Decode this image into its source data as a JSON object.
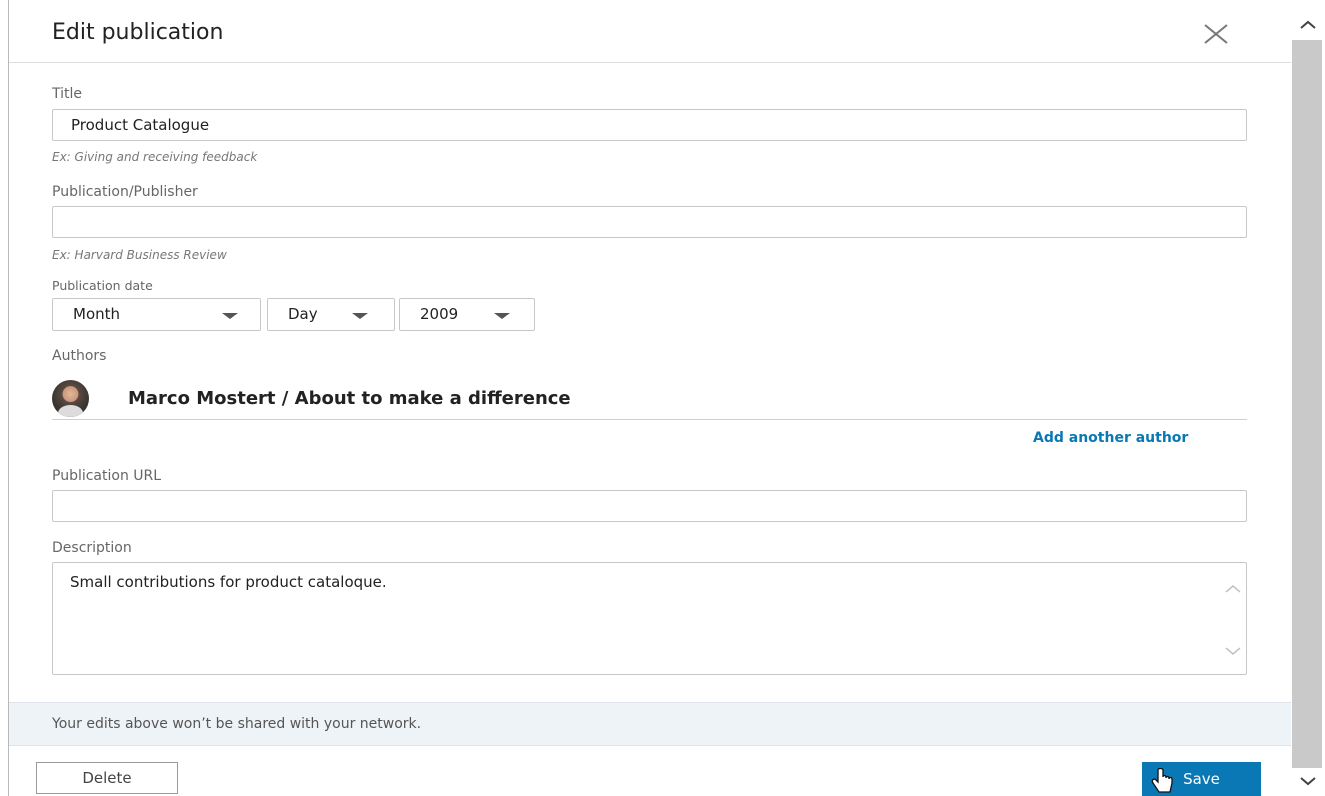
{
  "dialog": {
    "title": "Edit publication",
    "close_icon": "close-icon"
  },
  "form": {
    "title": {
      "label": "Title",
      "value": "Product Catalogue",
      "hint": "Ex: Giving and receiving feedback"
    },
    "publisher": {
      "label": "Publication/Publisher",
      "value": "",
      "hint": "Ex: Harvard Business Review"
    },
    "publication_date": {
      "label": "Publication date",
      "month": "Month",
      "day": "Day",
      "year": "2009"
    },
    "authors": {
      "label": "Authors",
      "items": [
        {
          "name": "Marco Mostert / About to make a difference"
        }
      ],
      "add_label": "Add another author"
    },
    "url": {
      "label": "Publication URL",
      "value": ""
    },
    "description": {
      "label": "Description",
      "value": "Small contributions for product cataloque."
    }
  },
  "notice": "Your edits above won’t be shared with your network.",
  "footer": {
    "delete_label": "Delete",
    "save_label": "Save"
  },
  "colors": {
    "accent": "#0a78b5",
    "notice_bg": "#eef3f7"
  }
}
